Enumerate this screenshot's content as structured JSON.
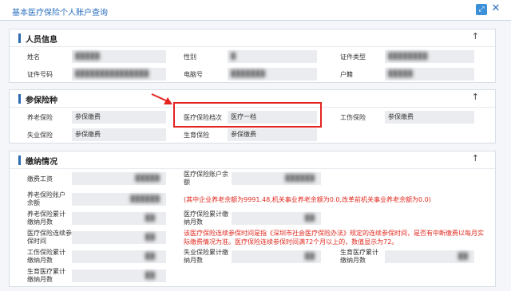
{
  "window": {
    "title": "基本医疗保险个人账户查询",
    "maximize_icon": "maximize-icon",
    "close_icon": "close-icon",
    "close_glyph": "✕",
    "maximize_glyph": "⤢"
  },
  "panels": {
    "personal": {
      "title": "人员信息",
      "collapse_glyph": "↑",
      "fields": {
        "name_label": "姓名",
        "name_value": "█████",
        "gender_label": "性别",
        "gender_value": "█",
        "idtype_label": "证件类型",
        "idtype_value": "████████",
        "idno_label": "证件号码",
        "idno_value": "███████████████",
        "pc_label": "电脑号",
        "pc_value": "███████",
        "hukou_label": "户籍",
        "hukou_value": "█████"
      }
    },
    "insurance": {
      "title": "参保险种",
      "collapse_glyph": "↑",
      "fields": {
        "pension_label": "养老保险",
        "pension_value": "参保缴费",
        "medical_label": "医疗保险档次",
        "medical_value": "医疗一档",
        "injury_label": "工伤保险",
        "injury_value": "参保缴费",
        "unemp_label": "失业保险",
        "unemp_value": "参保缴费",
        "maternity_label": "生育保险",
        "maternity_value": "参保缴费"
      }
    },
    "payment": {
      "title": "缴纳情况",
      "collapse_glyph": "↑",
      "fields": {
        "wage_label": "缴费工资",
        "wage_value": "█████",
        "med_balance_label": "医疗保险账户余额",
        "med_balance_value": "██████",
        "pension_balance_label": "养老保险账户余额",
        "pension_balance_value": "██████",
        "pension_balance_note": "(其中企业养老余额为9991.48,机关事业养老余额为0.0,改革前机关事业养老余额为0.0)",
        "pension_months_label": "养老保险累计缴纳月数",
        "pension_months_value": "██",
        "med_months_label": "医疗保险累计缴纳月数",
        "med_months_value": "██",
        "med_cont_label": "医疗保险连续参保时间",
        "med_cont_value": "██",
        "med_cont_note": "该医疗保险连续参保时间是指《深圳市社会医疗保险办法》规定的连续参保时间，是否有中断缴费以每月实际缴费情况为准。医疗保险连续参保时间满72个月以上的，数值显示为72。",
        "injury_months_label": "工伤保险累计缴纳月数",
        "injury_months_value": "██",
        "unemp_months_label": "失业保险累计缴纳月数",
        "unemp_months_value": "██",
        "maternity_months_label": "生育医疗累计缴纳月数",
        "maternity_months_value": "██",
        "maternity_months2_label": "生育医疗累计缴纳月数",
        "maternity_months2_value": "██"
      }
    }
  },
  "colors": {
    "accent": "#2d6bb3",
    "title_blue": "#2a6fbf",
    "note_red": "#e0281e",
    "highlight_red": "#e52420"
  }
}
